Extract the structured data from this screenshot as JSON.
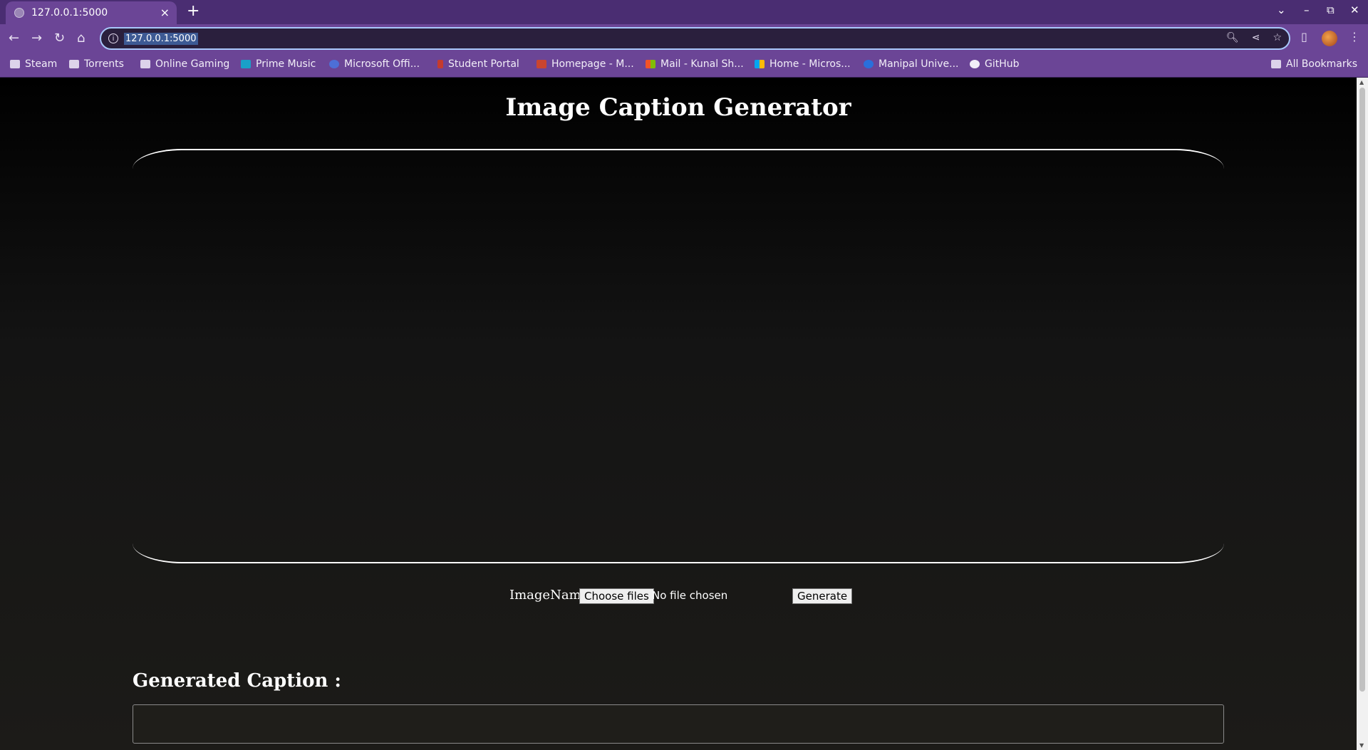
{
  "browser": {
    "tab_title": "127.0.0.1:5000",
    "tab_close": "×",
    "new_tab": "+",
    "url": "127.0.0.1:5000",
    "window_controls": [
      "⌄",
      "–",
      "⧉",
      "✕"
    ],
    "nav": {
      "back": "←",
      "forward": "→",
      "reload": "↻",
      "home": "⌂"
    },
    "bookmarks": [
      {
        "label": "Steam",
        "icon": "folder-icon"
      },
      {
        "label": "Torrents",
        "icon": "folder-icon"
      },
      {
        "label": "Online Gaming",
        "icon": "folder-icon"
      },
      {
        "label": "Prime Music",
        "icon": "prime-music-icon"
      },
      {
        "label": "Microsoft Offi...",
        "icon": "microsoft-office-icon"
      },
      {
        "label": "Student Portal",
        "icon": "student-portal-icon"
      },
      {
        "label": "Homepage - M...",
        "icon": "homepage-icon"
      },
      {
        "label": "Mail - Kunal Sh...",
        "icon": "microsoft-icon"
      },
      {
        "label": "Home - Micros...",
        "icon": "microsoft-icon"
      },
      {
        "label": "Manipal Unive...",
        "icon": "manipal-icon"
      },
      {
        "label": "GitHub",
        "icon": "github-icon"
      }
    ],
    "all_bookmarks": "All Bookmarks"
  },
  "page": {
    "title": "Image Caption Generator",
    "image_label": "ImageName:",
    "file_button": "Choose files",
    "file_status": "No file chosen",
    "generate_button": "Generate",
    "caption_heading": "Generated Caption :",
    "caption_value": ""
  }
}
